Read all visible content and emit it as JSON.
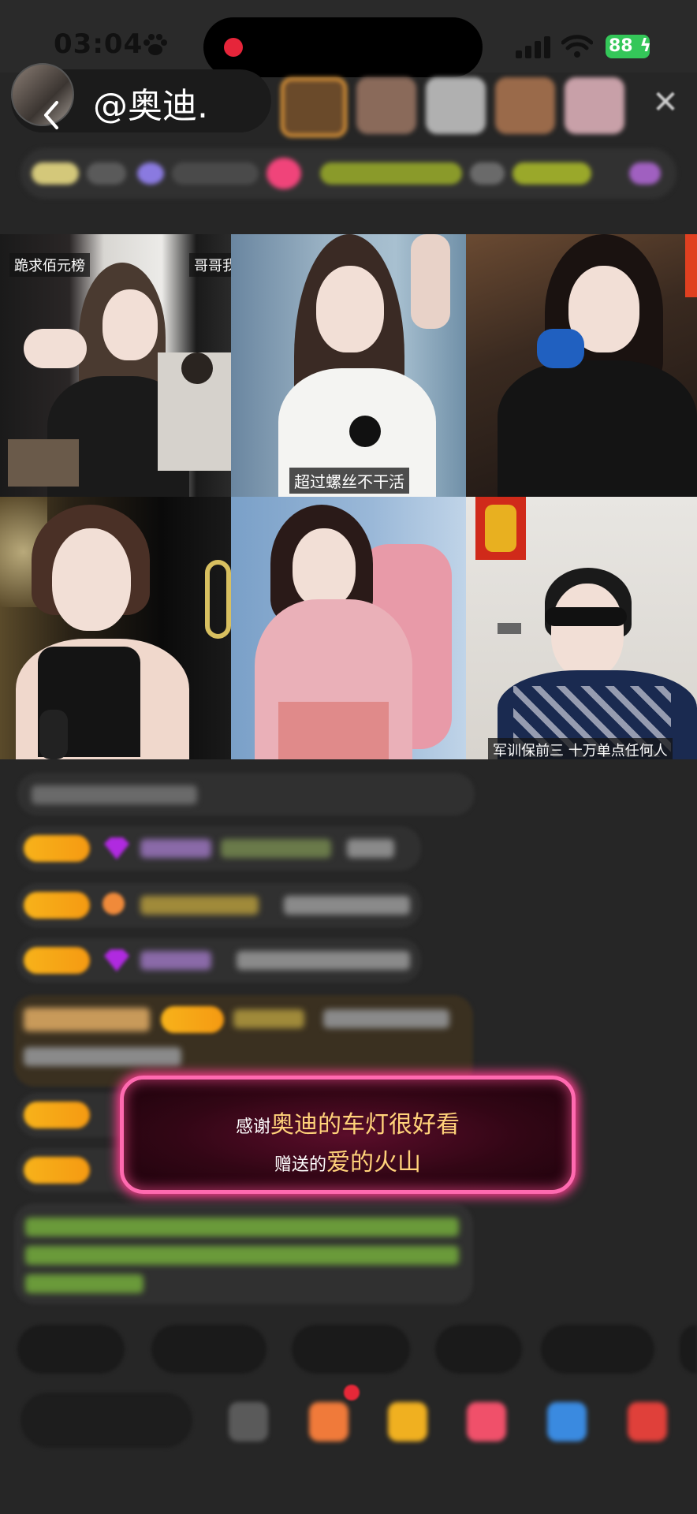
{
  "status_bar": {
    "time": "03:04",
    "battery": "88"
  },
  "header": {
    "host_name": "@奥迪."
  },
  "grid": {
    "cells": [
      {
        "caption_left": "跪求佰元榜",
        "caption_right": "哥哥我"
      },
      {
        "caption": "超过螺丝不干活"
      },
      {
        "caption": ""
      },
      {
        "caption": ""
      },
      {
        "caption": ""
      },
      {
        "caption": "军训保前三 十万单点任何人"
      }
    ]
  },
  "gift_banner": {
    "prefix": "感谢",
    "sender": "奥迪的车灯很好看",
    "mid": "赠送的",
    "gift": "爱的火山"
  },
  "colors": {
    "background": "#262626",
    "banner_border": "#ff6ab0",
    "banner_highlight": "#ffd27a",
    "level_badge": "#f7b21a",
    "battery": "#34c759"
  }
}
